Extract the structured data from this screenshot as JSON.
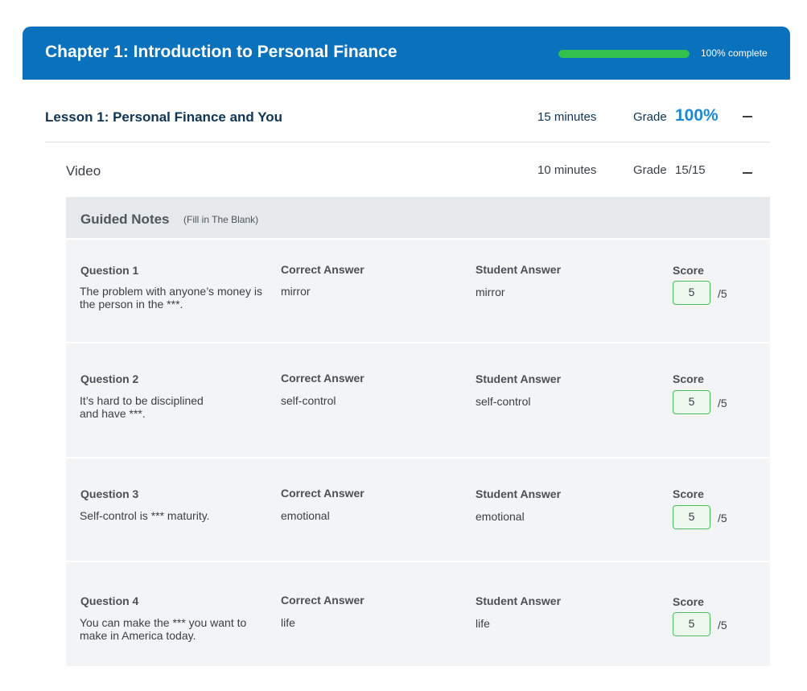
{
  "chapter": {
    "title": "Chapter 1: Introduction to Personal Finance",
    "progress_percent": 100,
    "progress_label": "100% complete",
    "colors": {
      "header": "#0a72bd",
      "progress": "#33c04d"
    }
  },
  "lesson": {
    "title": "Lesson 1: Personal Finance and You",
    "duration": "15 minutes",
    "grade_label": "Grade",
    "grade_value": "100%"
  },
  "video": {
    "title": "Video",
    "duration": "10 minutes",
    "grade_label": "Grade",
    "grade_value": "15/15"
  },
  "guided_notes": {
    "title": "Guided Notes",
    "subtitle": "(Fill in The Blank)",
    "columns": {
      "correct": "Correct Answer",
      "student": "Student Answer",
      "score": "Score"
    },
    "questions": [
      {
        "label": "Question 1",
        "text": "The problem with anyone’s money is the person in the ***.",
        "correct": "mirror",
        "student": "mirror",
        "score": "5",
        "max": "/5"
      },
      {
        "label": "Question 2",
        "text": "It’s hard to be disciplined and have ***.",
        "correct": "self-control",
        "student": "self-control",
        "score": "5",
        "max": "/5"
      },
      {
        "label": "Question 3",
        "text": "Self-control is *** maturity.",
        "correct": "emotional",
        "student": "emotional",
        "score": "5",
        "max": "/5"
      },
      {
        "label": "Question 4",
        "text": "You can make the *** you want to make in America today.",
        "correct": "life",
        "student": "life",
        "score": "5",
        "max": "/5"
      }
    ]
  }
}
